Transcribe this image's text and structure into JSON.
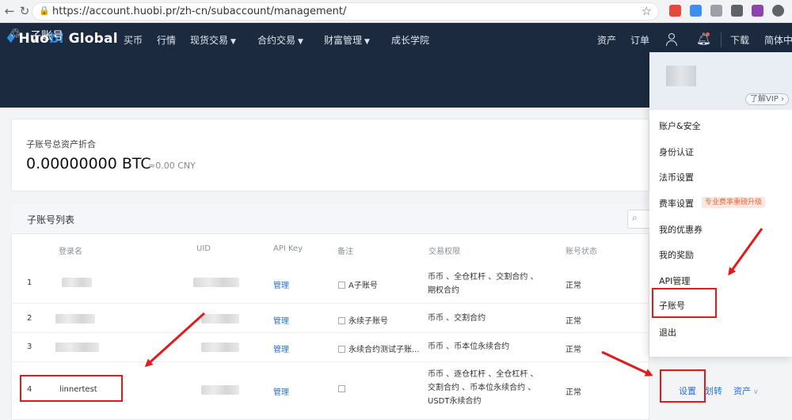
{
  "browser": {
    "url": "https://account.huobi.pr/zh-cn/subaccount/management/",
    "ext_colors": [
      "#e24a3b",
      "#3c8ef0",
      "#9aa0a6",
      "#5f6368",
      "#8e44ad",
      "#5f6368"
    ]
  },
  "header": {
    "logo_a": "Huo",
    "logo_b": "bi",
    "logo_c": " Global",
    "nav": [
      "买币",
      "行情",
      "现货交易",
      "合约交易",
      "财富管理",
      "成长学院"
    ],
    "right": [
      "资产",
      "订单"
    ],
    "download": "下载",
    "language": "简体中"
  },
  "page": {
    "title": "子账号"
  },
  "summary": {
    "label": "子账号总资产折合",
    "btc": "0.00000000 BTC",
    "cny": "≈0.00 CNY"
  },
  "list": {
    "title": "子账号列表",
    "columns": [
      "登录名",
      "UID",
      "API Key",
      "备注",
      "交易权限",
      "账号状态"
    ],
    "rows": [
      {
        "index": "1",
        "login": "",
        "api": "管理",
        "note": "A子账号",
        "perm": [
          "币币 、全仓杠杆 、交割合约 、",
          "期权合约"
        ],
        "status": "正常"
      },
      {
        "index": "2",
        "login": "",
        "api": "管理",
        "note": "永续子账号",
        "perm": [
          "币币 、交割合约"
        ],
        "status": "正常"
      },
      {
        "index": "3",
        "login": "",
        "api": "管理",
        "note": "永续合约测试子账...",
        "perm": [
          "币币 、币本位永续合约"
        ],
        "status": "正常"
      },
      {
        "index": "4",
        "login": "linnertest",
        "api": "管理",
        "note": "",
        "perm": [
          "币币 、逐仓杠杆 、全仓杠杆 、",
          "交割合约 、币本位永续合约 、",
          "USDT永续合约"
        ],
        "status": "正常"
      }
    ],
    "actions": {
      "settings": "设置",
      "transfer": "划转",
      "assets": "资产"
    }
  },
  "dropdown": {
    "vip": "了解VIP",
    "items": [
      "账户&安全",
      "身份认证",
      "法币设置",
      "费率设置",
      "我的优惠券",
      "我的奖励",
      "API管理",
      "子账号",
      "退出"
    ],
    "fee_tag": "专业费率重磅升级"
  }
}
